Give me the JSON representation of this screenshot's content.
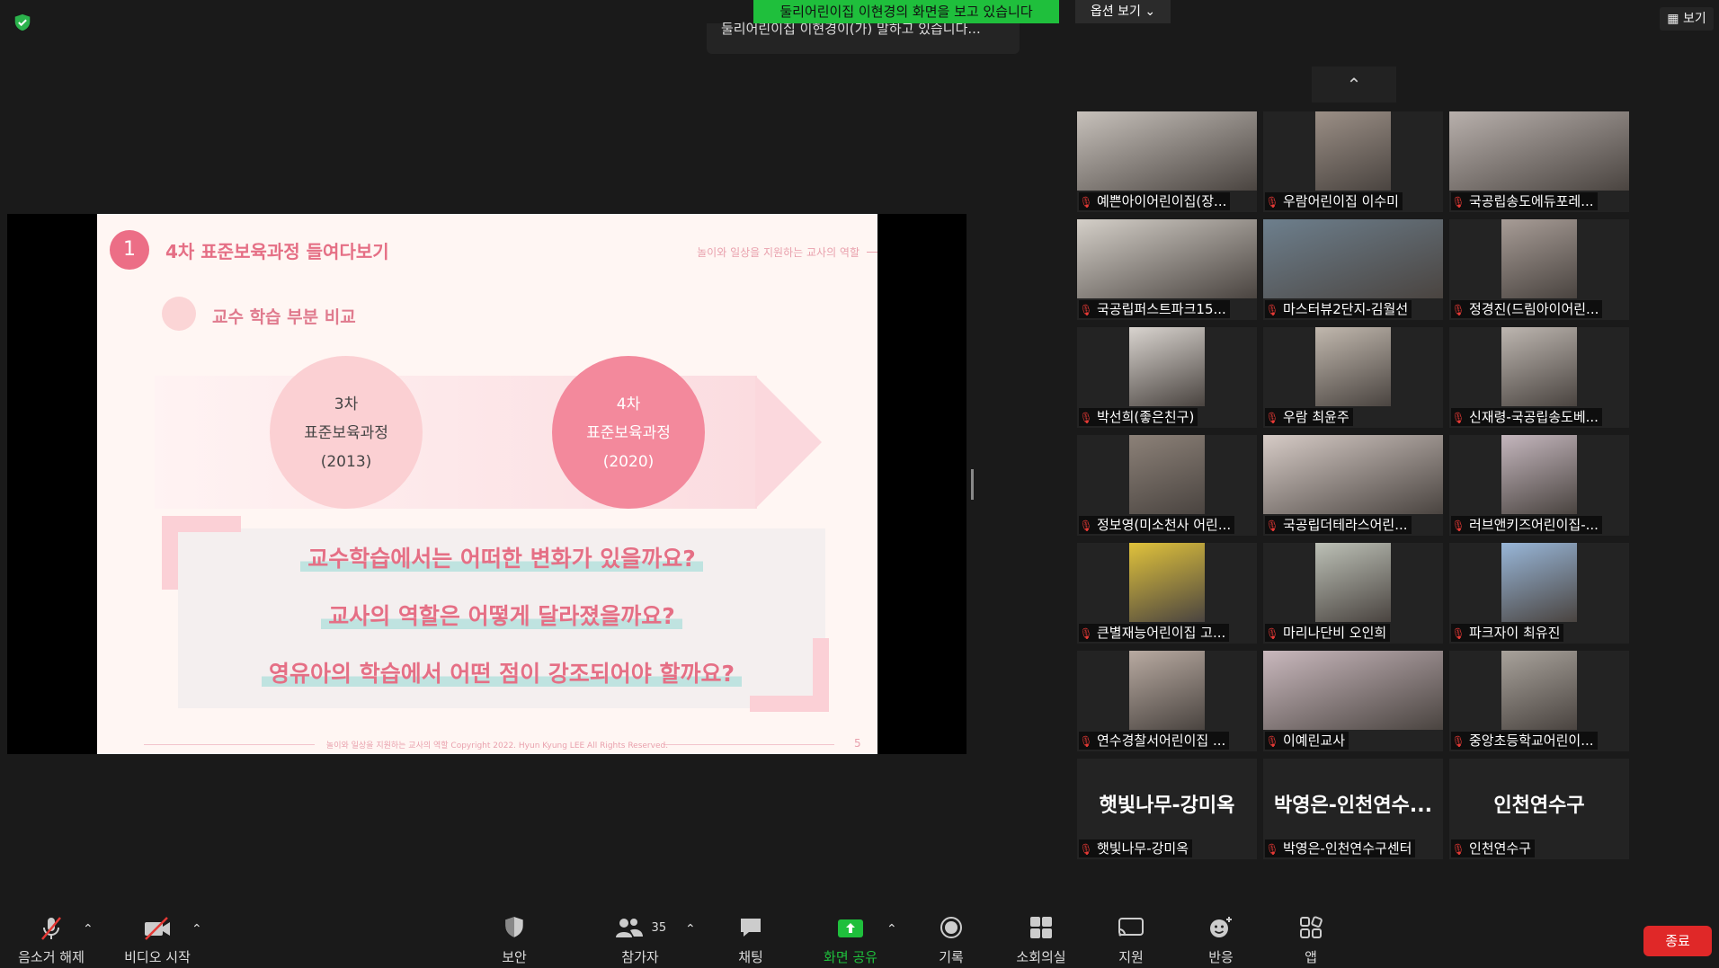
{
  "banner": {
    "text": "둘리어린이집 이현경의 화면을 보고 있습니다"
  },
  "notice": {
    "text": "둘리어린이집 이현경이(가) 말하고 있습니다..."
  },
  "view_options": {
    "label": "옵션 보기 ⌄"
  },
  "view_button": {
    "label": "보기"
  },
  "slide": {
    "number": "1",
    "title": "4차 표준보육과정 들여다보기",
    "header_right": "놀이와 일상을 지원하는 교사의 역할",
    "subtitle": "교수 학습 부분 비교",
    "circle1": {
      "line1": "3차",
      "line2": "표준보육과정",
      "line3": "(2013)"
    },
    "circle2": {
      "line1": "4차",
      "line2": "표준보육과정",
      "line3": "(2020)"
    },
    "questions": [
      "교수학습에서는 어떠한 변화가 있을까요?",
      "교사의 역할은 어떻게 달라졌을까요?",
      "영유아의 학습에서 어떤 점이 강조되어야 할까요?"
    ],
    "footer": "놀이와 일상을 지원하는 교사의 역할 Copyright 2022. Hyun Kyung LEE All Rights Reserved.",
    "page": "5"
  },
  "gallery": {
    "scroll_up": "⌃",
    "participants": [
      {
        "name": "예쁜아이어린이집(장..."
      },
      {
        "name": "우람어린이집 이수미"
      },
      {
        "name": "국공립송도에듀포레..."
      },
      {
        "name": "국공립퍼스트파크15..."
      },
      {
        "name": "마스터뷰2단지-김월선"
      },
      {
        "name": "정경진(드림아이어린..."
      },
      {
        "name": "박선희(좋은친구)"
      },
      {
        "name": "우람 최윤주"
      },
      {
        "name": "신재령-국공립송도베..."
      },
      {
        "name": "정보영(미소천사 어린..."
      },
      {
        "name": "국공립더테라스어린..."
      },
      {
        "name": "러브앤키즈어린이집-..."
      },
      {
        "name": "큰별재능어린이집 고..."
      },
      {
        "name": "마리나단비 오인희"
      },
      {
        "name": "파크자이 최유진"
      },
      {
        "name": "연수경찰서어린이집 ..."
      },
      {
        "name": "이예린교사"
      },
      {
        "name": "중앙초등학교어린이..."
      },
      {
        "name": "햇빛나무-강미옥",
        "big": "햇빛나무-강미옥"
      },
      {
        "name": "박영은-인천연수구센터",
        "big": "박영은-인천연수..."
      },
      {
        "name": "인천연수구",
        "big": "인천연수구"
      }
    ]
  },
  "toolbar": {
    "unmute": "음소거 해제",
    "start_video": "비디오 시작",
    "security": "보안",
    "participants": "참가자",
    "participants_count": "35",
    "chat": "채팅",
    "share_screen": "화면 공유",
    "record": "기록",
    "breakout": "소회의실",
    "support": "지원",
    "reactions": "반응",
    "apps": "앱",
    "end": "종료"
  },
  "colors": {
    "accent_green": "#1fbf3c",
    "end_red": "#e02828",
    "slide_pink": "#e56f85"
  }
}
